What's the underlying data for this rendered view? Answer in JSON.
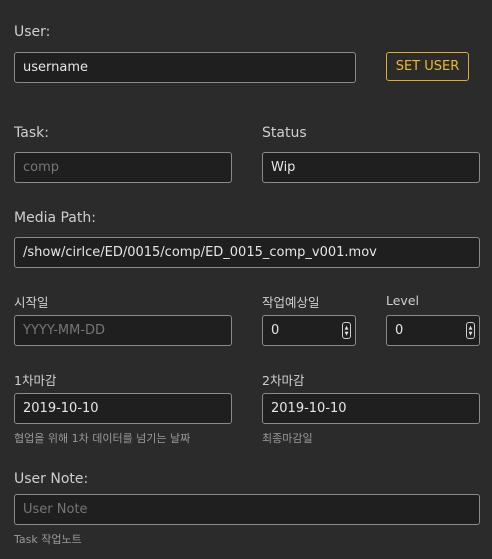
{
  "user": {
    "label": "User:",
    "value": "username",
    "set_button": "SET USER"
  },
  "task": {
    "label": "Task:",
    "placeholder": "comp"
  },
  "status": {
    "label": "Status",
    "value": "Wip"
  },
  "media_path": {
    "label": "Media Path:",
    "value": "/show/cirlce/ED/0015/comp/ED_0015_comp_v001.mov"
  },
  "start_date": {
    "label": "시작일",
    "placeholder": "YYYY-MM-DD"
  },
  "work_estimate": {
    "label": "작업예상일",
    "value": "0"
  },
  "level": {
    "label": "Level",
    "value": "0"
  },
  "deadline1": {
    "label": "1차마감",
    "value": "2019-10-10",
    "hint": "협업을 위해 1차 데이터를 넘기는 날짜"
  },
  "deadline2": {
    "label": "2차마감",
    "value": "2019-10-10",
    "hint": "최종마감일"
  },
  "user_note": {
    "label": "User Note:",
    "placeholder": "User Note",
    "hint": "Task 작업노트"
  },
  "icons": {
    "spinner_up": "▲",
    "spinner_down": "▼"
  },
  "colors": {
    "background": "#2b2b2b",
    "input_background": "#1f1f1f",
    "accent": "#f0b830"
  }
}
